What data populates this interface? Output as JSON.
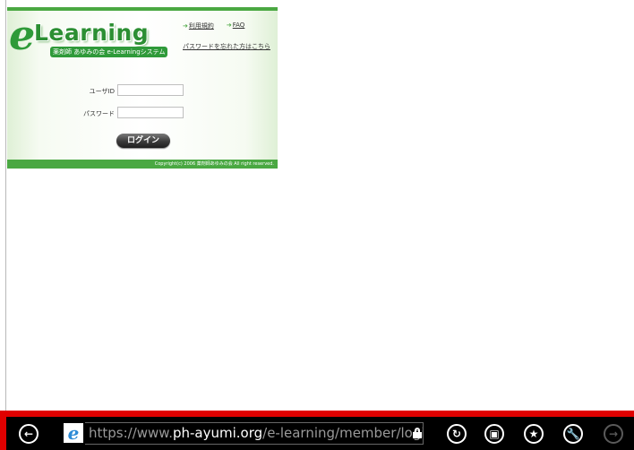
{
  "logo": {
    "letter": "e",
    "word": "Learning",
    "subtitle": "薬剤師 あゆみの会 e-Learningシステム"
  },
  "links": {
    "terms": "利用規約",
    "faq": "FAQ",
    "forgot_password": "パスワードを忘れた方はこちら"
  },
  "form": {
    "userid_label": "ユーザID",
    "password_label": "パスワード",
    "login_button": "ログイン"
  },
  "footer": {
    "copyright": "Copyright(c) 2006 薬剤師あゆみの会 All right reserved."
  },
  "addressbar": {
    "url_prefix": "https://www.",
    "url_domain": "ph-ayumi.org",
    "url_path": "/e-learning/member/login.php",
    "icons": {
      "back": "back-icon",
      "site": "ie-icon",
      "lock": "lock-icon",
      "refresh": "refresh-icon",
      "tabs": "tabs-icon",
      "favorite": "star-icon",
      "tools": "wrench-icon",
      "forward": "forward-icon"
    }
  },
  "colors": {
    "brand_green": "#4aa842",
    "bar_border": "#e00000",
    "bar_bg": "#000000"
  }
}
